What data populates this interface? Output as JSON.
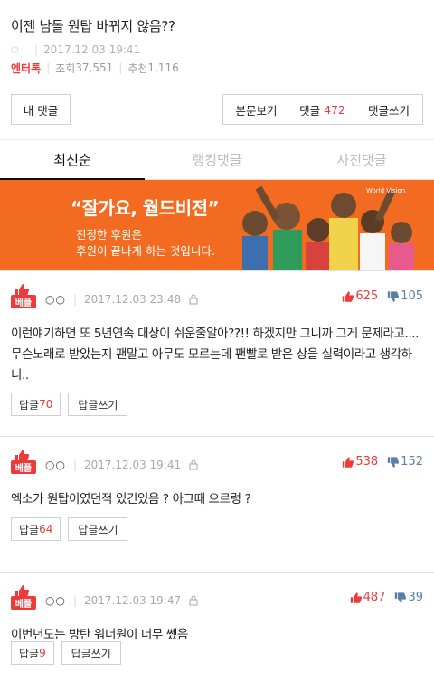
{
  "post": {
    "title": "이젠 남돌 원탑 바뀌지 않음??",
    "author_icon": "circle-icon",
    "date": "2017.12.03 19:41",
    "category": "엔터톡",
    "views_label": "조회",
    "views": "37,551",
    "recommend_label": "추천",
    "recommend": "1,116"
  },
  "toolbar": {
    "my_comments": "내 댓글",
    "view_body": "본문보기",
    "comments_label": "댓글",
    "comments_count": "472",
    "write_comment": "댓글쓰기"
  },
  "tabs": [
    "최신순",
    "랭킹댓글",
    "사진댓글"
  ],
  "active_tab": 0,
  "banner": {
    "headline": "“잘가요, 월드비전”",
    "line1": "진정한 후원은",
    "line2": "후원이 끝나게 하는 것입니다.",
    "logo": "World Vision"
  },
  "comments": [
    {
      "badge": "베플",
      "nick": "○○",
      "date": "2017.12.03 23:48",
      "up": "625",
      "down": "105",
      "text": "이런얘기하면 또 5년연속 대상이 쉬운줄알아??!! 하겠지만 그니까 그게 문제라고.... 무슨노래로 받았는지 팬말고 아무도 모르는데 팬빨로 받은 상을 실력이라고 생각하니..",
      "reply_label": "답글",
      "reply_count": "70",
      "reply_write": "답글쓰기"
    },
    {
      "badge": "베플",
      "nick": "○○",
      "date": "2017.12.03 19:41",
      "up": "538",
      "down": "152",
      "text": "엑소가 원탑이였던적 있긴있음 ? 아그때 으르렁 ?",
      "reply_label": "답글",
      "reply_count": "64",
      "reply_write": "답글쓰기"
    },
    {
      "badge": "베플",
      "nick": "○○",
      "date": "2017.12.03 19:47",
      "up": "487",
      "down": "39",
      "text": "이번년도는 방탄 워너원이 너무 쎘음",
      "reply_label": "답글",
      "reply_count": "9",
      "reply_write": "답글쓰기"
    }
  ],
  "colors": {
    "accent": "#ef3a3a",
    "down": "#5b7ea8",
    "banner": "#f26b21"
  }
}
